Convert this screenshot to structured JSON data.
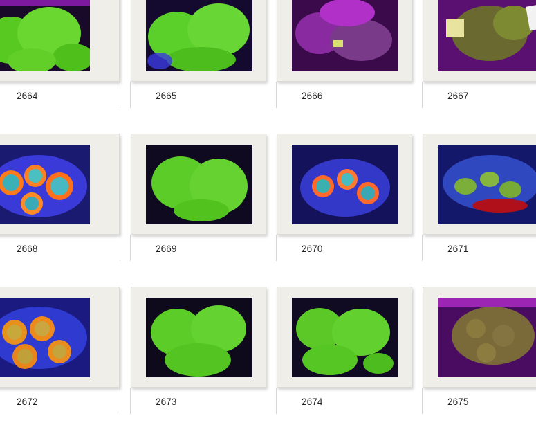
{
  "gallery": {
    "items": [
      {
        "id": "2664",
        "label": "2664",
        "theme": "green"
      },
      {
        "id": "2665",
        "label": "2665",
        "theme": "green"
      },
      {
        "id": "2666",
        "label": "2666",
        "theme": "purple"
      },
      {
        "id": "2667",
        "label": "2667",
        "theme": "purple-olive"
      },
      {
        "id": "2668",
        "label": "2668",
        "theme": "blue-orange"
      },
      {
        "id": "2669",
        "label": "2669",
        "theme": "green"
      },
      {
        "id": "2670",
        "label": "2670",
        "theme": "blue-orange"
      },
      {
        "id": "2671",
        "label": "2671",
        "theme": "blue-red"
      },
      {
        "id": "2672",
        "label": "2672",
        "theme": "orange"
      },
      {
        "id": "2673",
        "label": "2673",
        "theme": "green"
      },
      {
        "id": "2674",
        "label": "2674",
        "theme": "green"
      },
      {
        "id": "2675",
        "label": "2675",
        "theme": "purple-olive"
      }
    ]
  },
  "colors": {
    "frame": "#efeee9",
    "green": "#5fd12a",
    "purple": "#a020c8",
    "blue": "#2b3bd0",
    "orange": "#ff7a1a"
  }
}
